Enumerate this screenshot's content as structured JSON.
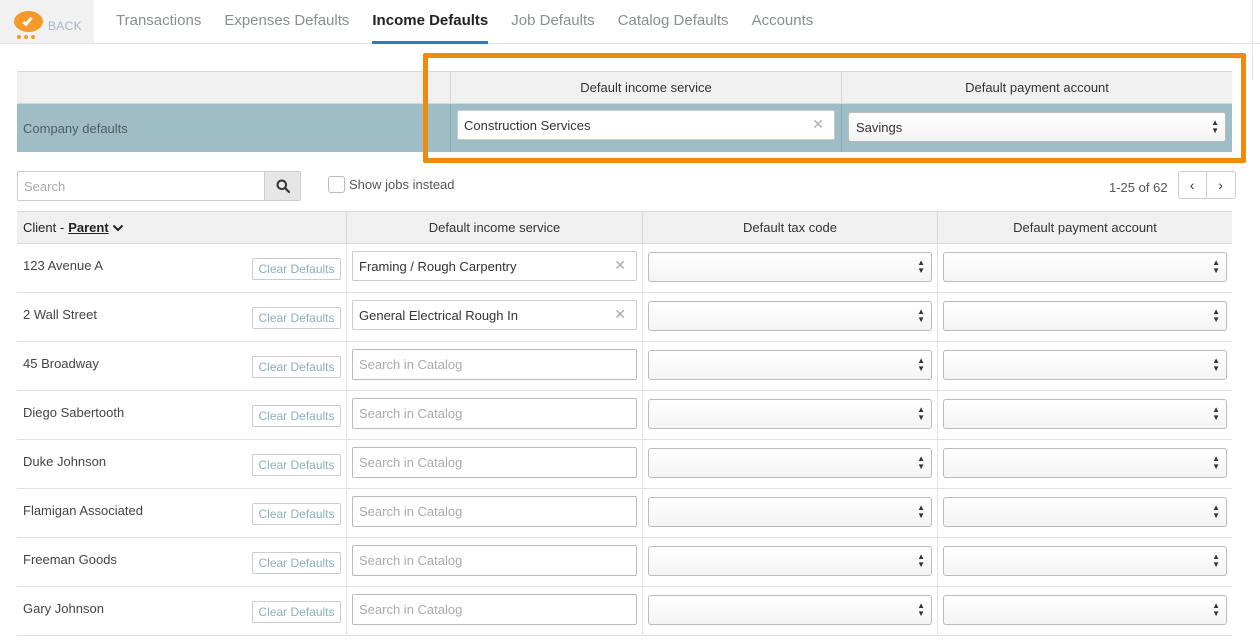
{
  "nav": {
    "back_label": "BACK",
    "tabs": [
      {
        "label": "Transactions",
        "active": false
      },
      {
        "label": "Expenses Defaults",
        "active": false
      },
      {
        "label": "Income Defaults",
        "active": true
      },
      {
        "label": "Job Defaults",
        "active": false
      },
      {
        "label": "Catalog Defaults",
        "active": false
      },
      {
        "label": "Accounts",
        "active": false
      }
    ]
  },
  "company": {
    "col_income": "Default income service",
    "col_payment": "Default payment account",
    "row_label": "Company defaults",
    "income_value": "Construction Services",
    "payment_value": "Savings"
  },
  "toolbar": {
    "search_placeholder": "Search",
    "show_jobs_label": "Show jobs instead",
    "pager_text": "1-25 of 62"
  },
  "table": {
    "header_client": "Client -",
    "header_parent": "Parent",
    "header_income": "Default income service",
    "header_tax": "Default tax code",
    "header_payment": "Default payment account",
    "clear_label": "Clear Defaults",
    "catalog_placeholder": "Search in Catalog",
    "rows": [
      {
        "client": "123 Avenue A",
        "service": "Framing / Rough Carpentry"
      },
      {
        "client": "2 Wall Street",
        "service": "General Electrical Rough In"
      },
      {
        "client": "45 Broadway",
        "service": ""
      },
      {
        "client": "Diego Sabertooth",
        "service": ""
      },
      {
        "client": "Duke Johnson",
        "service": ""
      },
      {
        "client": "Flamigan Associated",
        "service": ""
      },
      {
        "client": "Freeman Goods",
        "service": ""
      },
      {
        "client": "Gary Johnson",
        "service": ""
      }
    ]
  },
  "colors": {
    "accent_orange": "#f08a0c",
    "active_tab_underline": "#2e7cb8",
    "company_row_bg": "#9fbdc6"
  }
}
